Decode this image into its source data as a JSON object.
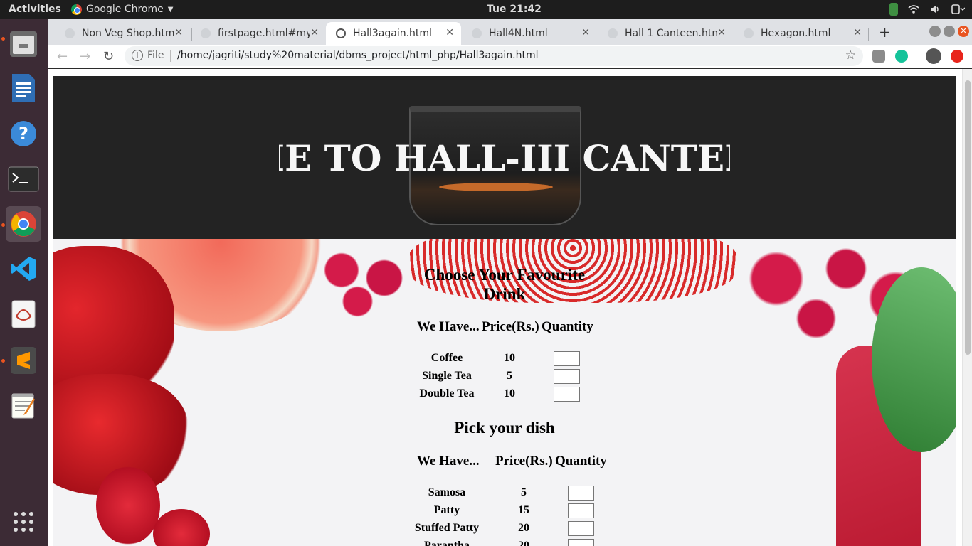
{
  "system": {
    "activities": "Activities",
    "app_menu": "Google Chrome",
    "clock": "Tue 21:42"
  },
  "browser": {
    "tabs": [
      {
        "title": "Non Veg Shop.htm"
      },
      {
        "title": "firstpage.html#my"
      },
      {
        "title": "Hall3again.html",
        "active": true
      },
      {
        "title": "Hall4N.html"
      },
      {
        "title": "Hall 1 Canteen.htm"
      },
      {
        "title": "Hexagon.html"
      }
    ],
    "omnibox": {
      "scheme": "File",
      "url": "/home/jagriti/study%20material/dbms_project/html_php/Hall3again.html"
    }
  },
  "page": {
    "banner_text": "WELCOME TO HALL-III CANTEEN",
    "drinks": {
      "heading_line1": "Choose Your Favourite",
      "heading_line2": "Drink",
      "col_item": "We Have...",
      "col_price": "Price(Rs.)",
      "col_qty": "Quantity",
      "items": [
        {
          "name": "Coffee",
          "price": "10"
        },
        {
          "name": "Single Tea",
          "price": "5"
        },
        {
          "name": "Double Tea",
          "price": "10"
        }
      ]
    },
    "dishes": {
      "heading": "Pick your dish",
      "col_item": "We Have...",
      "col_price": "Price(Rs.)",
      "col_qty": "Quantity",
      "items": [
        {
          "name": "Samosa",
          "price": "5"
        },
        {
          "name": "Patty",
          "price": "15"
        },
        {
          "name": "Stuffed Patty",
          "price": "20"
        },
        {
          "name": "Parantha",
          "price": "20"
        }
      ]
    }
  }
}
